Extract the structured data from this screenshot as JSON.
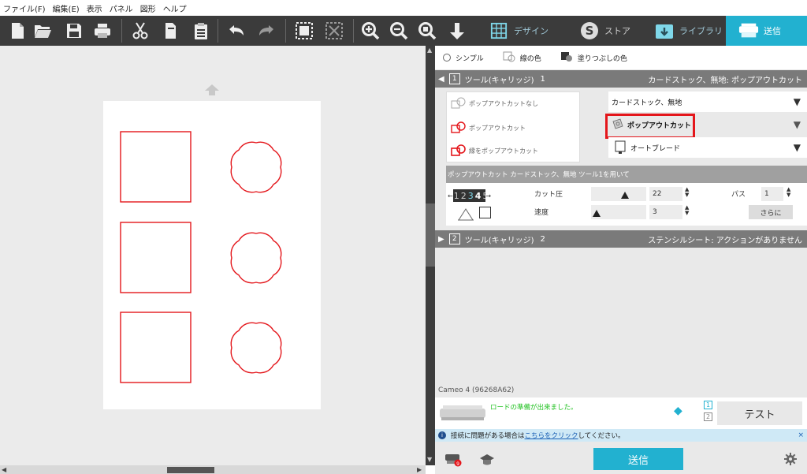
{
  "menu": {
    "items": [
      "ファイル(F)",
      "編集(E)",
      "表示",
      "パネル",
      "図形",
      "ヘルプ"
    ]
  },
  "toolbar": {
    "icons": [
      "new-file-icon",
      "open-folder-icon",
      "save-icon",
      "print-icon",
      "cut-icon",
      "copy-icon",
      "paste-icon",
      "undo-icon",
      "redo-icon",
      "group-icon",
      "ungroup-icon",
      "zoom-in-icon",
      "zoom-out-icon",
      "zoom-fit-icon",
      "move-icon"
    ]
  },
  "nav_tabs": {
    "design": "デザイン",
    "store": "ストア",
    "library": "ライブラリ",
    "send": "送信"
  },
  "colors": {
    "accent": "#22b1d0",
    "toolbar_bg": "#3b3b3b",
    "cut_line": "#e4161b",
    "ready_text": "#22c222"
  },
  "panel": {
    "tabs": [
      "シンプル",
      "線の色",
      "塗りつぶしの色"
    ],
    "tool1": {
      "number": "1",
      "label": "ツール(キャリッジ)",
      "index": "1",
      "summary": "カードストック、無地: ポップアウトカット"
    },
    "actions": [
      "ポップアウトカットなし",
      "ポップアウトカット",
      "縁をポップアウトカット"
    ],
    "material": "カードストック、無地",
    "action_selected": "ポップアウトカット",
    "blade": "オートブレード",
    "settings_header": "ポップアウトカット カードストック、無地 ツール1を用いて",
    "blade_depth_digits": [
      "1",
      "2",
      "3",
      "4",
      "5"
    ],
    "force_label": "カット圧",
    "force_value": "22",
    "speed_label": "速度",
    "speed_value": "3",
    "passes_label": "パス",
    "passes_value": "1",
    "more_button": "さらに",
    "tool2": {
      "number": "2",
      "label": "ツール(キャリッジ)",
      "index": "2",
      "summary": "ステンシルシート: アクションがありません"
    },
    "machine": "Cameo 4 (96268A62)",
    "status": "ロードの準備が出来ました。",
    "tool_numbers": [
      "1",
      "2"
    ],
    "test_button": "テスト",
    "info": {
      "prefix": "接続に問題がある場合は",
      "link": "こちらをクリック",
      "suffix": "してください。",
      "close": "×"
    },
    "send_button": "送信"
  }
}
